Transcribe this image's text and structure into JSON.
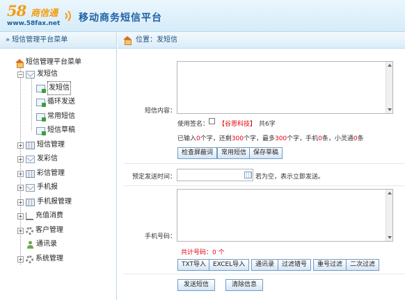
{
  "header": {
    "logo_number": "58",
    "logo_brand": "商信通",
    "logo_url": "www.58fax.net",
    "platform_title": "移动商务短信平台"
  },
  "sidebar": {
    "header": "» 短信管理平台菜单",
    "root": "短信管理平台菜单",
    "items": [
      {
        "label": "发短信",
        "expander": "⊟",
        "icon": "mail-icon"
      },
      {
        "label": "发短信",
        "icon": "doc-icon",
        "selected": true
      },
      {
        "label": "循环发送",
        "icon": "doc-icon"
      },
      {
        "label": "常用短信",
        "icon": "doc-icon"
      },
      {
        "label": "短信草稿",
        "icon": "doc-icon"
      },
      {
        "label": "短信管理",
        "expander": "⊞",
        "icon": "grid-icon"
      },
      {
        "label": "发彩信",
        "expander": "⊞",
        "icon": "mail-icon"
      },
      {
        "label": "彩信管理",
        "expander": "⊞",
        "icon": "grid-icon"
      },
      {
        "label": "手机报",
        "expander": "⊞",
        "icon": "mail-icon"
      },
      {
        "label": "手机报管理",
        "expander": "⊞",
        "icon": "grid-icon"
      },
      {
        "label": "充值消费",
        "expander": "⊞",
        "icon": "cart-icon"
      },
      {
        "label": "客户管理",
        "expander": "⊞",
        "icon": "gear-icon"
      },
      {
        "label": "通讯录",
        "icon": "person-icon"
      },
      {
        "label": "系统管理",
        "expander": "⊞",
        "icon": "gear-icon"
      }
    ]
  },
  "breadcrumb": {
    "label": "位置：发短信"
  },
  "form": {
    "content_label": "短信内容：",
    "content_value": "",
    "signature_label": "使用签名：",
    "signature_name": "【谷恩科技】",
    "signature_count": "共6字",
    "stats": {
      "p1": "已输入",
      "typed": "0",
      "p2": "个字，还剩",
      "remaining": "300",
      "p3": "个字，最多",
      "max": "300",
      "p4": "个字，手机",
      "phone_count": "0",
      "p5": "条，小灵通",
      "phs_count": "0",
      "p6": "条"
    },
    "buttons_content": [
      "检查屏蔽词",
      "常用短信",
      "保存草稿"
    ],
    "schedule_label": "预定发送时间：",
    "schedule_value": "",
    "schedule_hint": "若为空，表示立即发送。",
    "phone_label": "手机号码：",
    "phone_value": "",
    "phone_total": "共计号码：0 个",
    "buttons_phone": [
      "TXT导入",
      "EXCEL导入",
      "通讯录",
      "过滤错号",
      "重号过滤",
      "二次过滤"
    ],
    "send_button": "发送短信",
    "clear_button": "清除信息"
  }
}
